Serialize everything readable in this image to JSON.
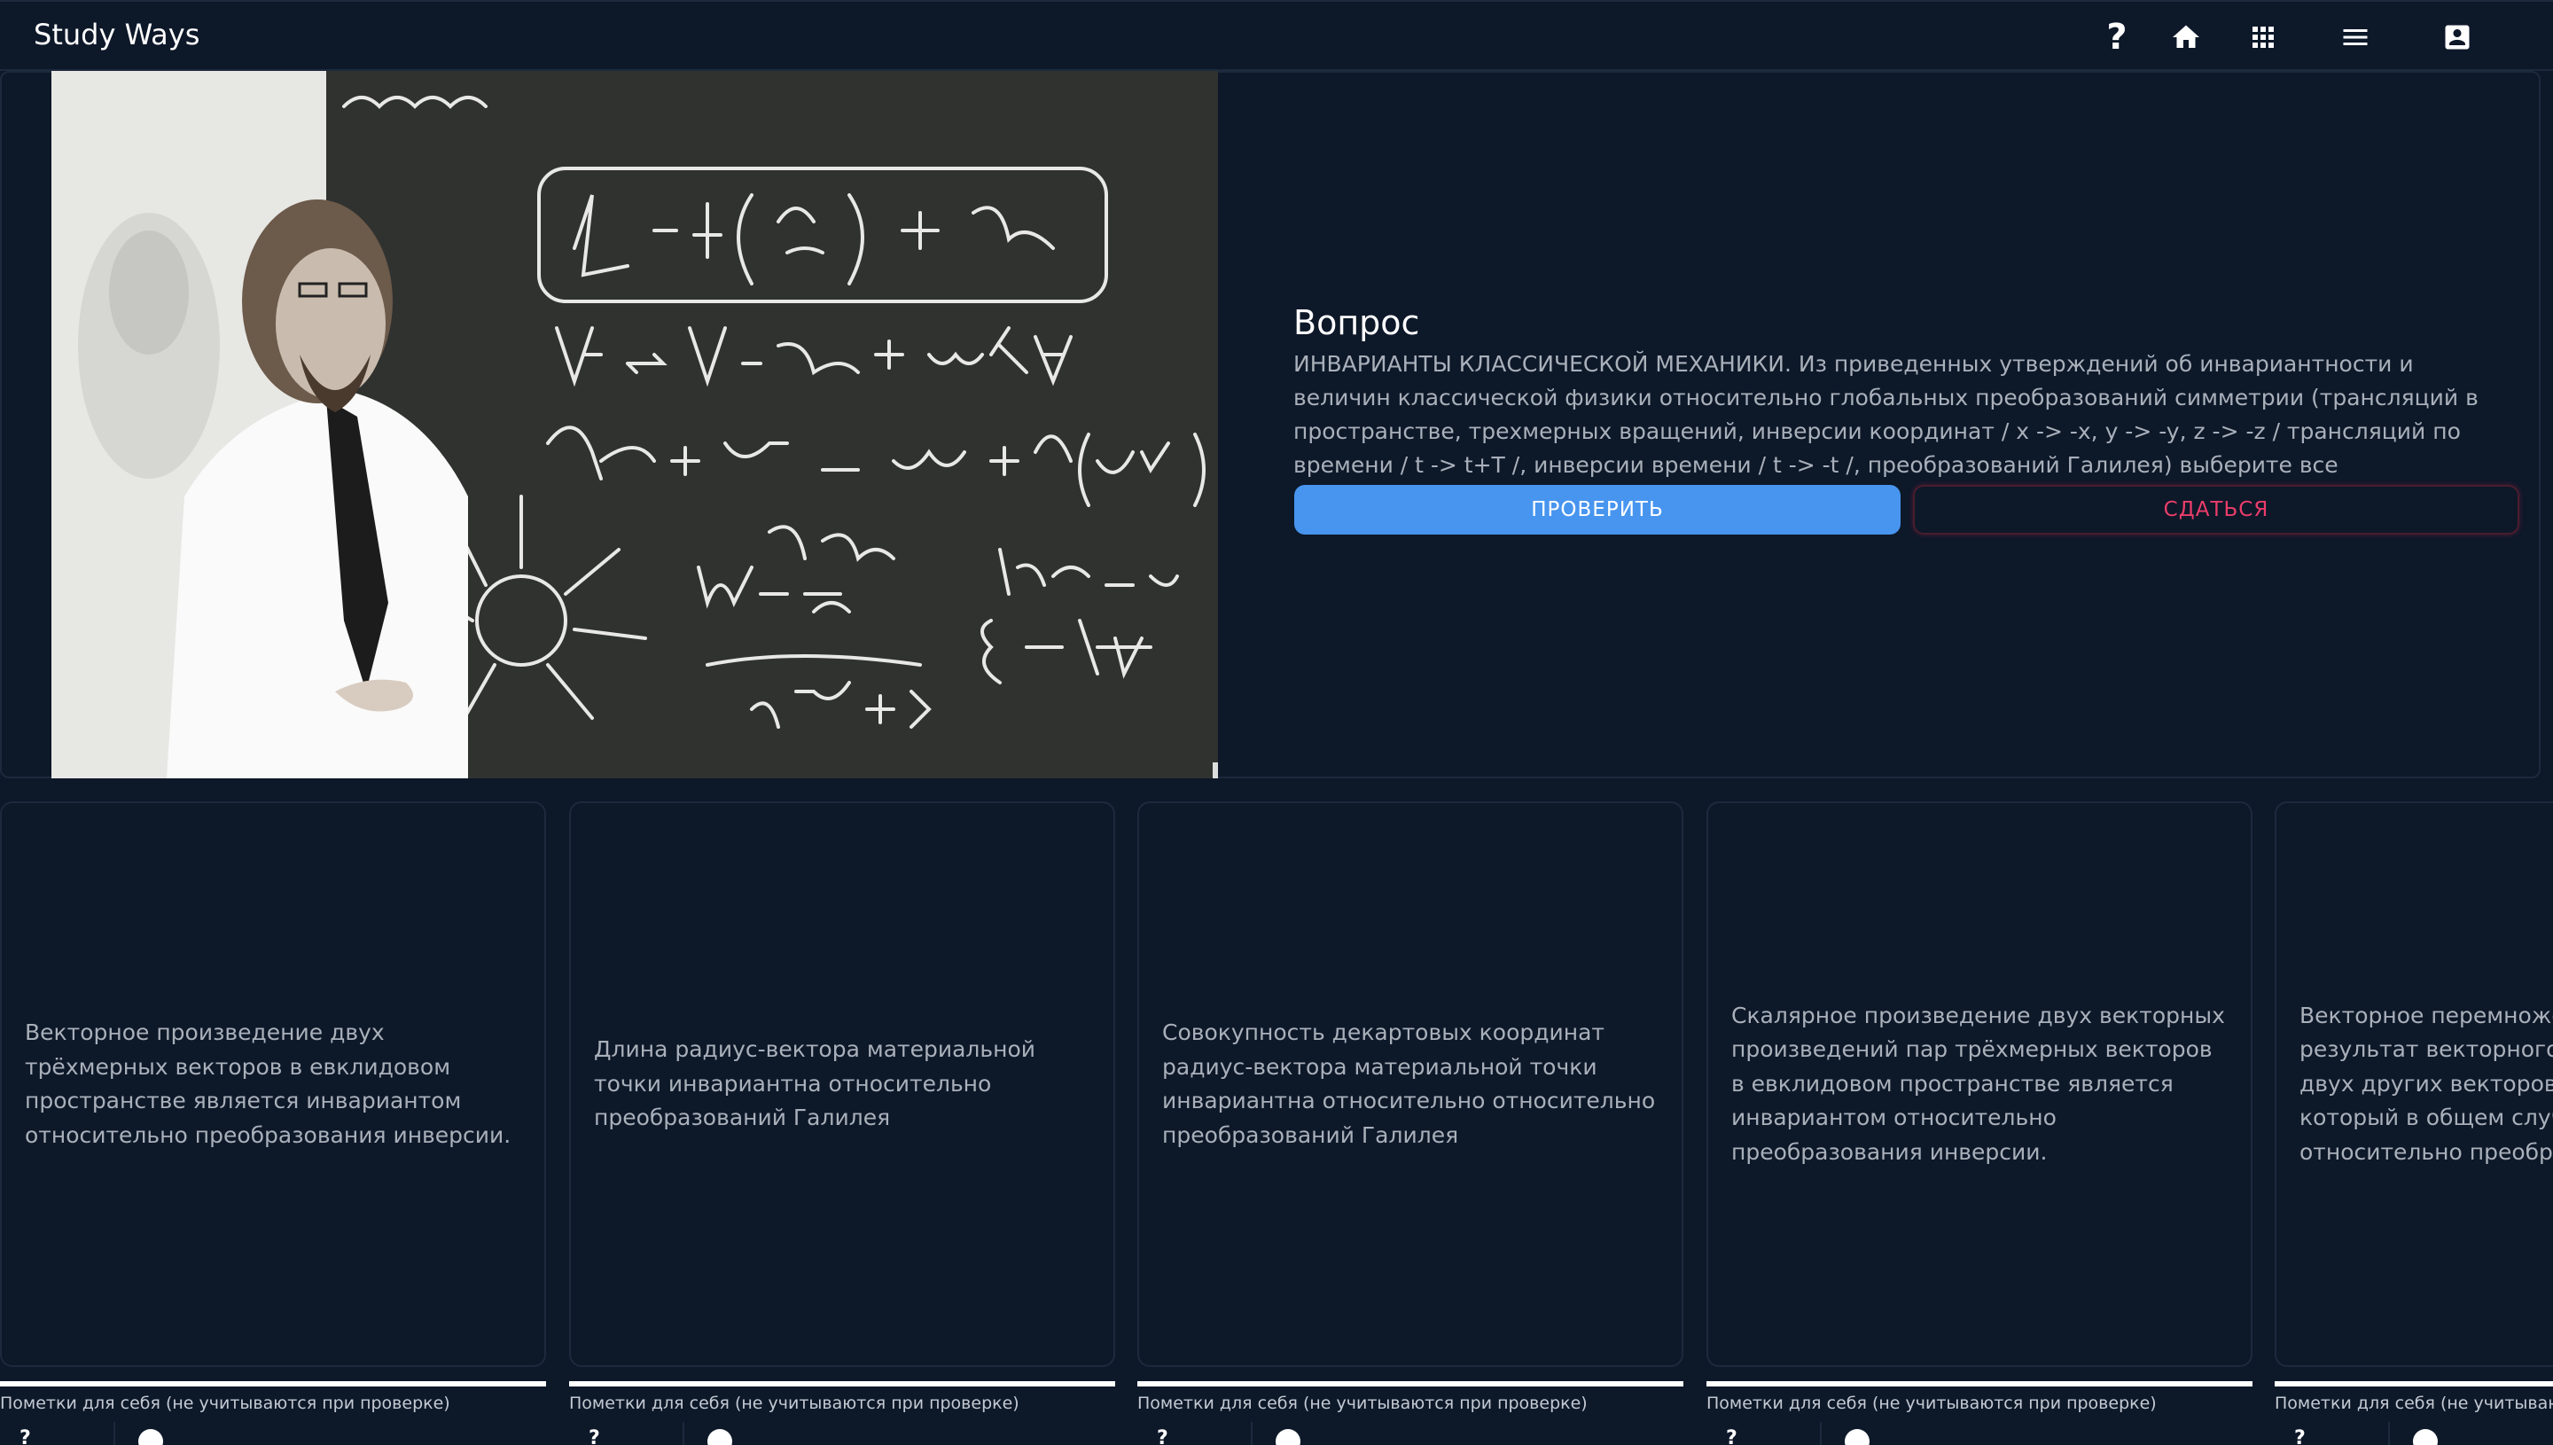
{
  "header": {
    "app_title": "Study Ways",
    "help_label": "?",
    "icons": [
      "help-icon",
      "home-icon",
      "apps-grid-icon",
      "menu-icon",
      "account-box-icon"
    ]
  },
  "question": {
    "heading": "Вопрос",
    "text": "ИНВАРИАНТЫ КЛАССИЧЕСКОЙ МЕХАНИКИ. Из приведенных утверждений об инвариантности и величин классической физики относительно глобальных преобразований симметрии (трансляций в пространстве, трехмерных вращений, инверсии координат / x -> -x, y -> -y, z -> -z / трансляций по времени / t -> t+T /, инверсии времени / t -> -t /, преобразований Галилея) выберите все правильные",
    "check_label": "ПРОВЕРИТЬ",
    "giveup_label": "СДАТЬСЯ"
  },
  "answers": [
    {
      "text": "Векторное произведение двух трёхмерных векторов в евклидовом пространстве является инвариантом относительно преобразования инверсии.",
      "note_label": "Пометки для себя (не учитываются при проверке)"
    },
    {
      "text": "Длина радиус-вектора материальной точки инвариантна относительно преобразований Галилея",
      "note_label": "Пометки для себя (не учитываются при проверке)"
    },
    {
      "text": "Совокупность декартовых координат радиус-вектора материальной точки инвариантна относительно относительно преобразований Галилея",
      "note_label": "Пометки для себя (не учитываются при проверке)"
    },
    {
      "text": "Скалярное произведение двух векторных произведений пар трёхмерных векторов в евклидовом пространстве является инвариантом относительно преобразования инверсии.",
      "note_label": "Пометки для себя (не учитываются при проверке)"
    },
    {
      "text": "Векторное перемножение вектора на результат векторного перемножения двух других векторов даёт вектор, который в общем случае не инвариантен относительно преобразования инверсии",
      "note_label": "Пометки для себя (не учитываются при проверке)"
    }
  ],
  "colors": {
    "background": "#0d1829",
    "border": "#1d2a3d",
    "primary_button": "#4895ef",
    "danger": "#ec3d6a",
    "text_muted": "#a9b0ba"
  }
}
